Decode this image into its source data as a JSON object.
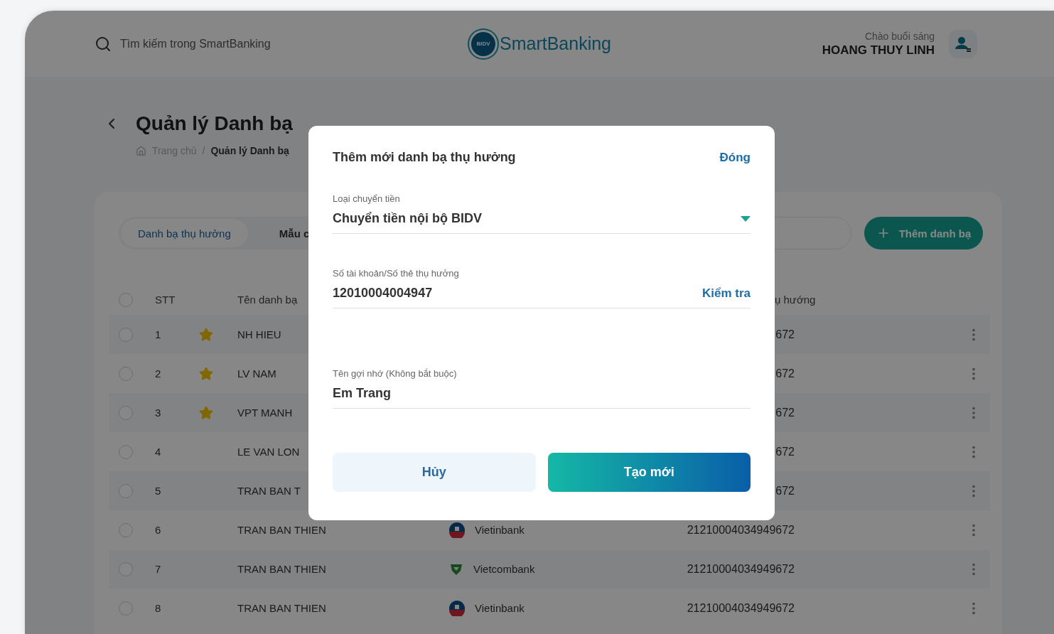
{
  "header": {
    "search": {
      "placeholder": "Tìm kiếm trong SmartBanking"
    },
    "logo": {
      "badge": "BIDV",
      "name": "SmartBanking"
    },
    "user": {
      "greeting": "Chào buổi sáng",
      "name": "HOANG THUY LINH"
    }
  },
  "page": {
    "title": "Quản lý Danh bạ",
    "breadcrumb": [
      "Trang chủ",
      "Quản lý Danh bạ"
    ],
    "breadcrumb_separator": "/"
  },
  "tabs": [
    {
      "label": "Danh bạ thụ hưởng",
      "selected": true
    },
    {
      "label": "Mẫu c",
      "selected": false
    }
  ],
  "add_button": "Thêm danh bạ",
  "table": {
    "all_checked": false,
    "columns": [
      "STT",
      "Tên danh bạ",
      "ụ hướng"
    ],
    "rows": [
      {
        "checked": false,
        "index": "1",
        "favorite": true,
        "name": "NH HIEU",
        "account": "672"
      },
      {
        "checked": false,
        "index": "2",
        "favorite": true,
        "name": "LV NAM",
        "account": "672"
      },
      {
        "checked": false,
        "index": "3",
        "favorite": true,
        "name": "VPT MANH",
        "account": "672"
      },
      {
        "checked": false,
        "index": "4",
        "favorite": false,
        "name": "LE VAN LON",
        "account": "672"
      },
      {
        "checked": false,
        "index": "5",
        "favorite": false,
        "name": "TRAN BAN T",
        "account": "672"
      },
      {
        "checked": false,
        "index": "6",
        "favorite": false,
        "name": "TRAN BAN THIEN",
        "bank": {
          "name": "Vietinbank",
          "kind": "round"
        },
        "account": "21210004034949672"
      },
      {
        "checked": false,
        "index": "7",
        "favorite": false,
        "name": "TRAN BAN THIEN",
        "bank": {
          "name": "Vietcombank",
          "kind": "shield"
        },
        "account": "21210004034949672"
      },
      {
        "checked": false,
        "index": "8",
        "favorite": false,
        "name": "TRAN BAN THIEN",
        "bank": {
          "name": "Vietinbank",
          "kind": "round"
        },
        "account": "21210004034949672"
      }
    ]
  },
  "dialog": {
    "title": "Thêm mới danh bạ thụ hưởng",
    "close": "Đóng",
    "fields": [
      {
        "kind": "select",
        "label": "Loại chuyển tiền",
        "value": "Chuyển tiền nội bộ BIDV"
      },
      {
        "kind": "action",
        "label": "Số tài khoản/Số thẻ thụ hưởng",
        "value": "12010004004947",
        "action": "Kiểm tra"
      },
      {
        "kind": "text",
        "label": "Tên gợi nhớ (Không bắt buộc)",
        "value": "Em Trang"
      }
    ],
    "buttons": [
      {
        "label": "Hủy",
        "kind": "secondary"
      },
      {
        "label": "Tạo mới",
        "kind": "primary"
      }
    ]
  }
}
